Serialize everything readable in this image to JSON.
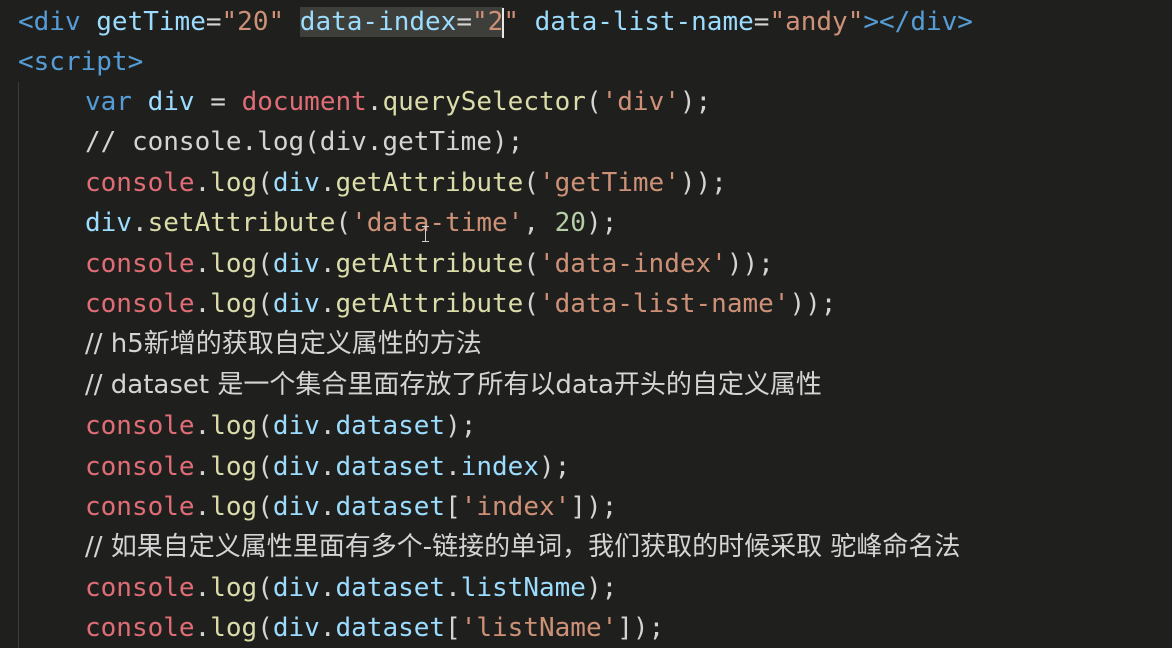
{
  "colors": {
    "background": "#1f201d",
    "tag": "#569cd6",
    "attribute": "#9cdcfe",
    "string": "#ce9178",
    "keyword": "#569cd6",
    "identifier": "#9cdcfe",
    "method": "#dcdcaa",
    "object": "#e06c75",
    "comment": "#d4d4d4",
    "number": "#b5cea8",
    "punctuation": "#d4d4d4",
    "selection": "#3e3f3a"
  },
  "code": {
    "line1": {
      "open_tag": "<div",
      "attr1": "getTime",
      "eq1": "=",
      "val1": "\"20\"",
      "attr2": "data-index",
      "eq2": "=",
      "val2_selected": "\"2",
      "val2_rest": "\"",
      "attr3": "data-list-name",
      "eq3": "=",
      "val3": "\"andy\"",
      "close": "></div>"
    },
    "line2": {
      "tag": "<script>"
    },
    "line3": {
      "kw": "var",
      "name": "div",
      "op": " = ",
      "obj": "document",
      "dot": ".",
      "method": "querySelector",
      "open": "(",
      "arg": "'div'",
      "close": ");"
    },
    "line4": {
      "comment": "// console.log(div.getTime);"
    },
    "line5": {
      "obj": "console",
      "dot": ".",
      "method": "log",
      "open": "(",
      "target": "div",
      "dot2": ".",
      "method2": "getAttribute",
      "open2": "(",
      "arg": "'getTime'",
      "close": "));"
    },
    "line6": {
      "target": "div",
      "dot": ".",
      "method": "setAttribute",
      "open": "(",
      "arg": "'data-time'",
      "comma": ", ",
      "num": "20",
      "close": ");"
    },
    "line7": {
      "obj": "console",
      "dot": ".",
      "method": "log",
      "open": "(",
      "target": "div",
      "dot2": ".",
      "method2": "getAttribute",
      "open2": "(",
      "arg": "'data-index'",
      "close": "));"
    },
    "line8": {
      "obj": "console",
      "dot": ".",
      "method": "log",
      "open": "(",
      "target": "div",
      "dot2": ".",
      "method2": "getAttribute",
      "open2": "(",
      "arg": "'data-list-name'",
      "close": "));"
    },
    "line9": {
      "comment": "// h5新增的获取自定义属性的方法"
    },
    "line10": {
      "comment": "// dataset 是一个集合里面存放了所有以data开头的自定义属性"
    },
    "line11": {
      "obj": "console",
      "dot": ".",
      "method": "log",
      "open": "(",
      "target": "div",
      "dot2": ".",
      "prop": "dataset",
      "close": ");"
    },
    "line12": {
      "obj": "console",
      "dot": ".",
      "method": "log",
      "open": "(",
      "target": "div",
      "dot2": ".",
      "prop": "dataset",
      "dot3": ".",
      "prop2": "index",
      "close": ");"
    },
    "line13": {
      "obj": "console",
      "dot": ".",
      "method": "log",
      "open": "(",
      "target": "div",
      "dot2": ".",
      "prop": "dataset",
      "open2": "[",
      "arg": "'index'",
      "close": "]);"
    },
    "line14": {
      "comment": "// 如果自定义属性里面有多个-链接的单词，我们获取的时候采取 驼峰命名法"
    },
    "line15": {
      "obj": "console",
      "dot": ".",
      "method": "log",
      "open": "(",
      "target": "div",
      "dot2": ".",
      "prop": "dataset",
      "dot3": ".",
      "prop2": "listName",
      "close": ");"
    },
    "line16": {
      "obj": "console",
      "dot": ".",
      "method": "log",
      "open": "(",
      "target": "div",
      "dot2": ".",
      "prop": "dataset",
      "open2": "[",
      "arg": "'listName'",
      "close": "]);"
    }
  }
}
